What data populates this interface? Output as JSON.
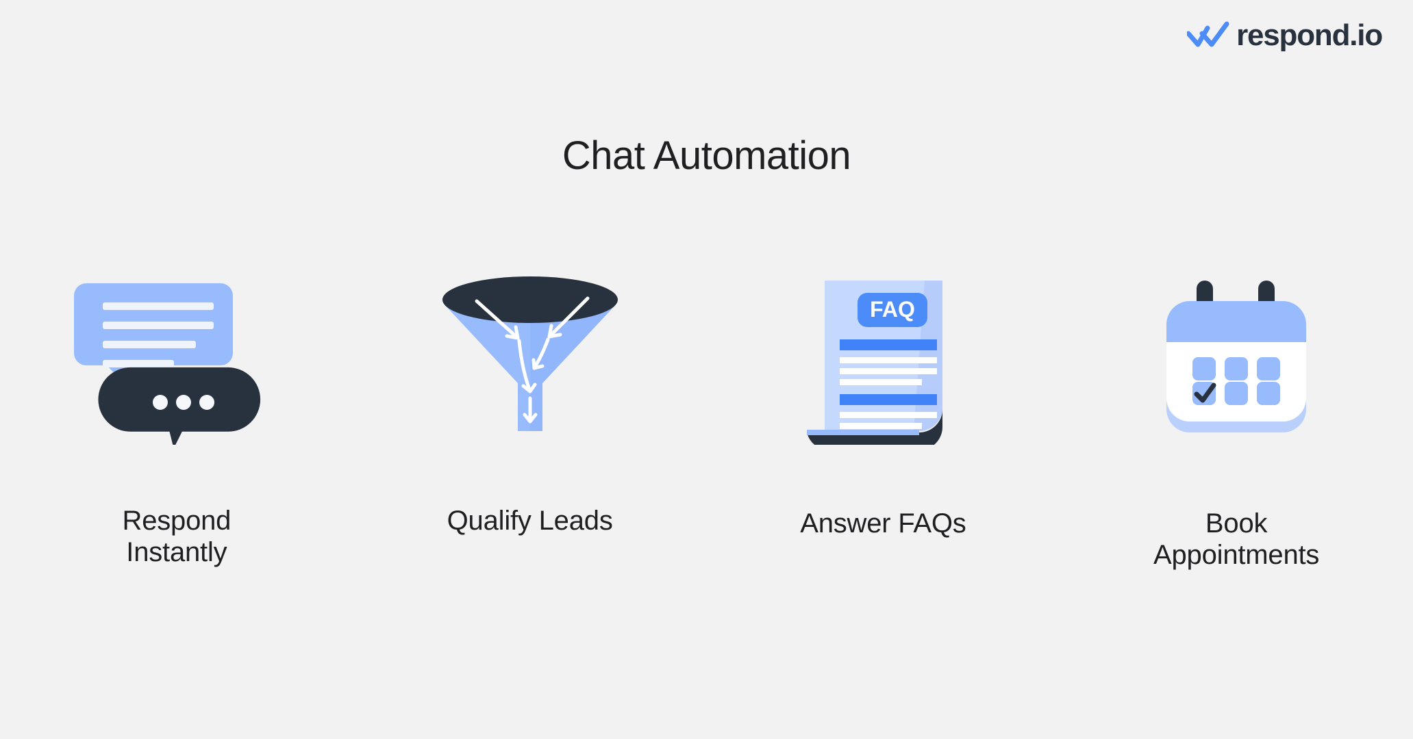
{
  "brand": {
    "name": "respond.io",
    "logo_icon": "double-check-icon",
    "logo_color": "#4c8cf8",
    "text_color": "#28323f"
  },
  "page": {
    "title": "Chat Automation",
    "background_color": "#f2f2f2",
    "text_color": "#1f1f22"
  },
  "palette": {
    "light_blue": "#97bbfc",
    "mid_blue": "#a9c6fd",
    "accent_blue": "#4c8cf8",
    "dark_navy": "#28323f",
    "white": "#ffffff",
    "page_blue": "#c5d8fd"
  },
  "cards": [
    {
      "id": "respond-instantly",
      "label": "Respond\nInstantly",
      "icon": "chat-bubbles-icon",
      "icon_description": "Blue speech bubble with four white text lines above a dark navy bubble with three white typing dots"
    },
    {
      "id": "qualify-leads",
      "label": "Qualify Leads",
      "icon": "funnel-icon",
      "icon_description": "Dark navy elliptical funnel rim over a light blue cone and stem with white downward arrows"
    },
    {
      "id": "answer-faqs",
      "label": "Answer FAQs",
      "icon": "faq-document-icon",
      "icon_description": "Light blue document with a blue FAQ badge, two solid blue header bars, white text lines and a dark navy curled bottom edge",
      "badge_label": "FAQ"
    },
    {
      "id": "book-appointments",
      "label": "Book\nAppointments",
      "icon": "calendar-icon",
      "icon_description": "Calendar with blue header, two dark navy binder rings and six blue date squares, the lower-left one bearing a dark checkmark"
    }
  ]
}
